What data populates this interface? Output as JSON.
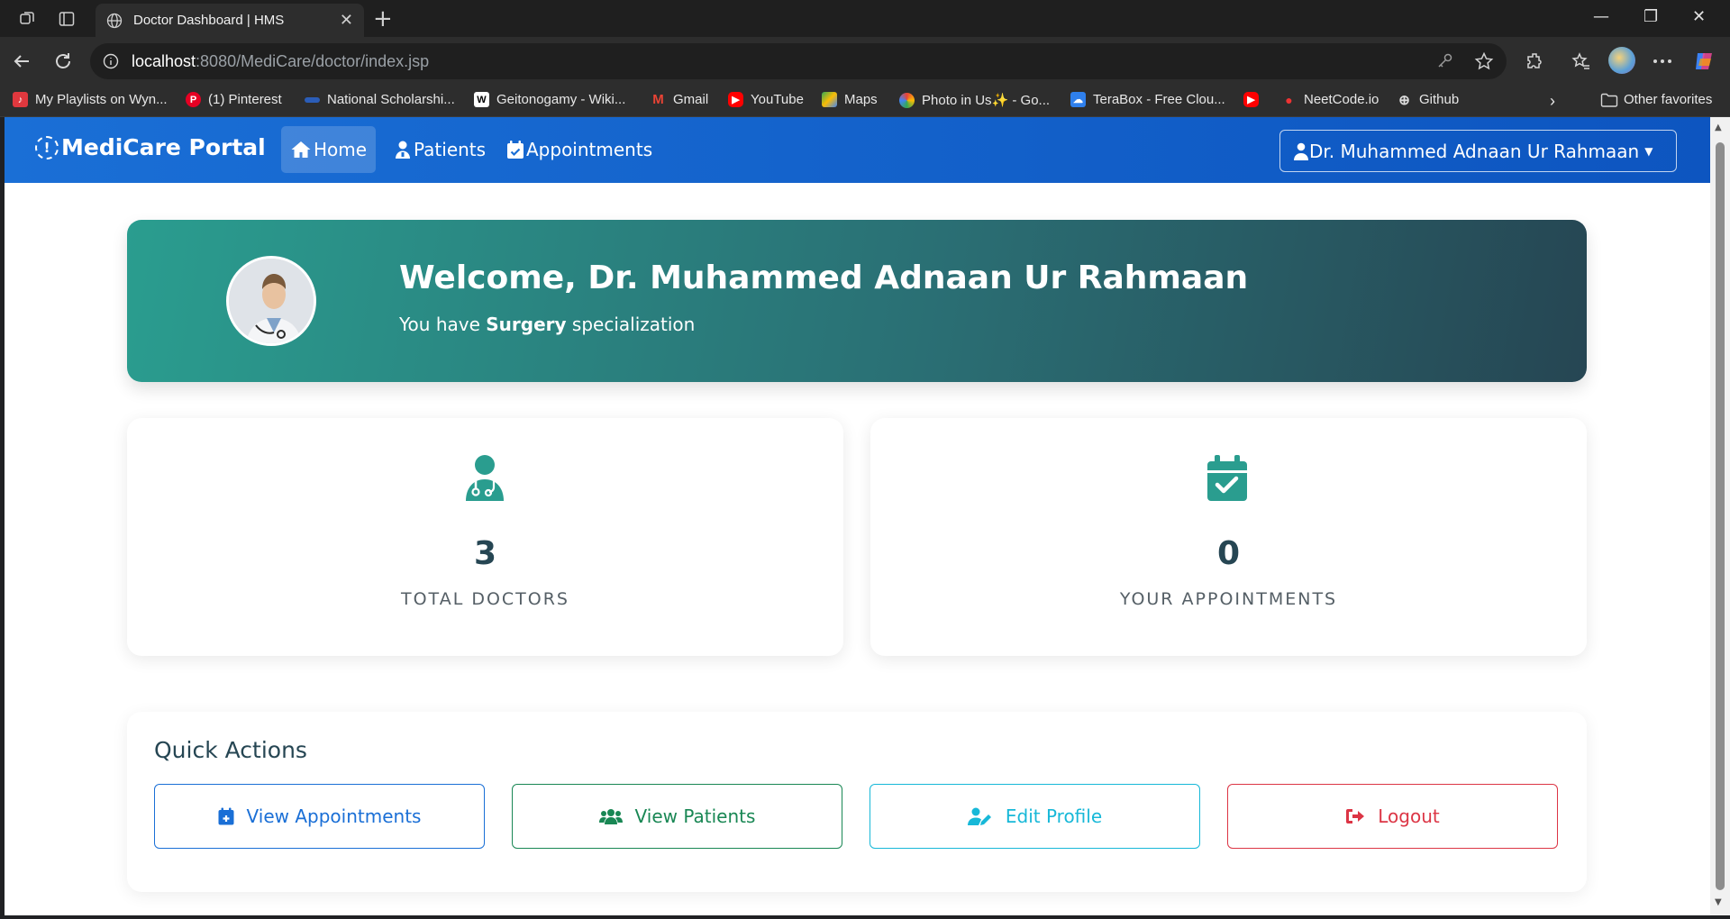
{
  "browser": {
    "tab_title": "Doctor Dashboard | HMS",
    "url_host": "localhost",
    "url_path": ":8080/MediCare/doctor/index.jsp",
    "bookmarks": [
      {
        "label": "My Playlists on Wyn...",
        "color": "#e0383e"
      },
      {
        "label": "(1) Pinterest",
        "color": "#e60023"
      },
      {
        "label": "National Scholarshi...",
        "color": "#2b5db8"
      },
      {
        "label": "Geitonogamy - Wiki...",
        "color": "#ffffff"
      },
      {
        "label": "Gmail",
        "color": "#ea4335"
      },
      {
        "label": "YouTube",
        "color": "#ff0000"
      },
      {
        "label": "Maps",
        "color": "#34a853"
      },
      {
        "label": "Photo in Us✨ - Go...",
        "color": "#fbbc05"
      },
      {
        "label": "TeraBox - Free Clou...",
        "color": "#2f80ed"
      },
      {
        "label": "",
        "color": "#ff0000"
      },
      {
        "label": "NeetCode.io",
        "color": "#444444"
      },
      {
        "label": "Github",
        "color": "#cccccc"
      }
    ],
    "other_favorites": "Other favorites"
  },
  "navbar": {
    "brand": "MediCare Portal",
    "links": [
      "Home",
      "Patients",
      "Appointments"
    ],
    "user": "Dr. Muhammed Adnaan Ur Rahmaan"
  },
  "welcome": {
    "title": "Welcome, Dr. Muhammed Adnaan Ur Rahmaan",
    "sub_prefix": "You have",
    "specialization": "Surgery",
    "sub_suffix": "specialization"
  },
  "stats": [
    {
      "value": "3",
      "label": "TOTAL DOCTORS",
      "icon": "doctor-icon"
    },
    {
      "value": "0",
      "label": "YOUR APPOINTMENTS",
      "icon": "calendar-check-icon"
    }
  ],
  "quick_actions": {
    "title": "Quick Actions",
    "buttons": [
      {
        "label": "View Appointments",
        "color": "#1a6fd6",
        "icon": "calendar-plus-icon"
      },
      {
        "label": "View Patients",
        "color": "#198754",
        "icon": "users-icon"
      },
      {
        "label": "Edit Profile",
        "color": "#17b8d8",
        "icon": "user-edit-icon"
      },
      {
        "label": "Logout",
        "color": "#dc3545",
        "icon": "logout-icon"
      }
    ]
  },
  "colors": {
    "navbar": "#1a6fd6",
    "teal": "#2a9d8f",
    "dark_teal": "#264653"
  }
}
